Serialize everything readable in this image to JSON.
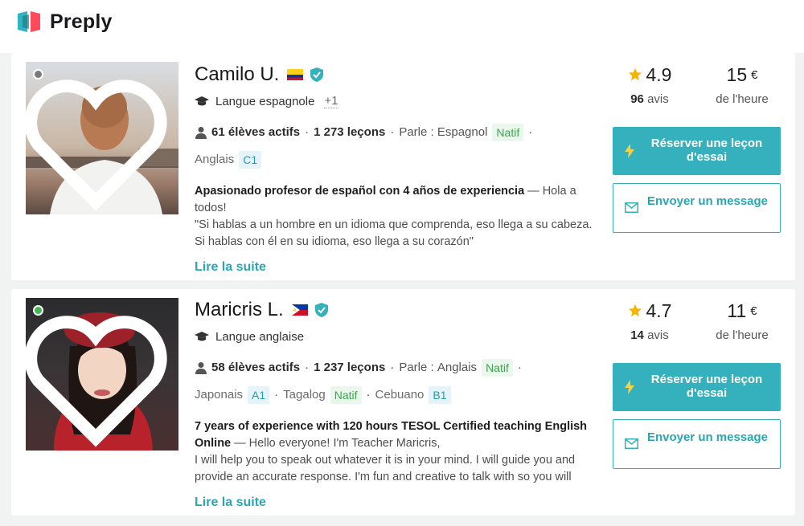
{
  "brand": {
    "name": "Preply"
  },
  "tutors": [
    {
      "name": "Camilo U.",
      "flag": "colombia-flag",
      "online": false,
      "subject": "Langue espagnole",
      "subject_extra": "+1",
      "students": "61 élèves actifs",
      "lessons": "1 273 leçons",
      "speaks_label": "Parle :",
      "languages": [
        {
          "name": "Espagnol",
          "level": "Natif",
          "style": "green"
        },
        {
          "name": "Anglais",
          "level": "C1",
          "style": "blue"
        }
      ],
      "headline": "Apasionado profesor de español con 4 años de experiencia",
      "intro": " — Hola a todos!",
      "desc_line": "\"Si hablas a un hombre en un idioma que comprenda, eso llega a su cabeza. Si hablas con él en su idioma, eso llega a su corazón\"",
      "read_more": "Lire la suite",
      "rating": "4.9",
      "reviews_count": "96",
      "reviews_label": "avis",
      "price": "15",
      "currency": "€",
      "price_unit": "de l'heure",
      "book_label": "Réserver une leçon d'essai",
      "message_label": "Envoyer un message"
    },
    {
      "name": "Maricris L.",
      "flag": "philippines-flag",
      "online": true,
      "subject": "Langue anglaise",
      "subject_extra": "",
      "students": "58 élèves actifs",
      "lessons": "1 237 leçons",
      "speaks_label": "Parle :",
      "languages": [
        {
          "name": "Anglais",
          "level": "Natif",
          "style": "green"
        },
        {
          "name": "Japonais",
          "level": "A1",
          "style": "blue"
        },
        {
          "name": "Tagalog",
          "level": "Natif",
          "style": "green"
        },
        {
          "name": "Cebuano",
          "level": "B1",
          "style": "blue"
        }
      ],
      "headline": "7 years of experience with 120 hours TESOL Certified teaching English Online",
      "intro": " — Hello everyone! I'm Teacher Maricris,",
      "desc_line": "I will help you to speak out whatever it is in your mind. I will guide you and provide an accurate response. I'm fun and creative to talk with so you will",
      "read_more": "Lire la suite",
      "rating": "4.7",
      "reviews_count": "14",
      "reviews_label": "avis",
      "price": "11",
      "currency": "€",
      "price_unit": "de l'heure",
      "book_label": "Réserver une leçon d'essai",
      "message_label": "Envoyer un message"
    }
  ],
  "colors": {
    "accent": "#34b1bd",
    "native_bg": "#e9f7ec",
    "level_bg": "#e4f4f8",
    "star": "#f5b400"
  }
}
